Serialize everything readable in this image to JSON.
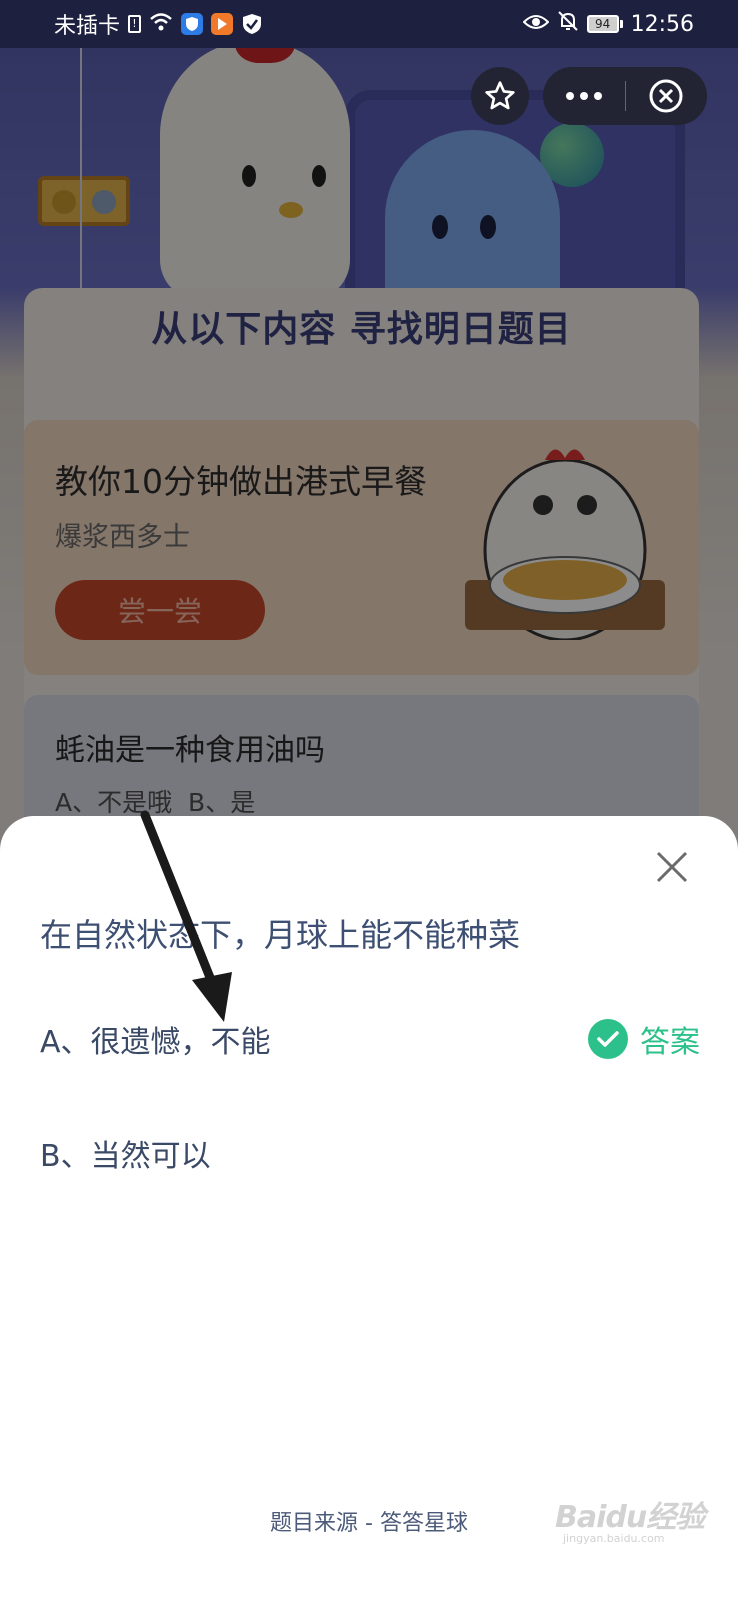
{
  "status_bar": {
    "carrier": "未插卡",
    "battery": "94",
    "time": "12:56"
  },
  "background_page": {
    "section_header": "从以下内容 寻找明日题目",
    "recipe_card": {
      "title": "教你10分钟做出港式早餐",
      "subtitle": "爆浆西多士",
      "button_label": "尝一尝"
    },
    "quiz_preview": {
      "question": "蚝油是一种食用油吗",
      "options": "A、不是哦 B、是"
    }
  },
  "sheet": {
    "question": "在自然状态下，月球上能不能种菜",
    "options": [
      {
        "label": "A、很遗憾，不能",
        "is_answer": true
      },
      {
        "label": "B、当然可以",
        "is_answer": false
      }
    ],
    "answer_label": "答案",
    "footer": "题目来源 - 答答星球"
  },
  "watermark": {
    "logo": "Baidu经验",
    "url": "jingyan.baidu.com"
  },
  "icons": {
    "fav": "star-icon",
    "more": "more-dots-icon",
    "close_miniapp": "close-circle-icon",
    "close_sheet": "close-icon",
    "check": "check-circle-icon"
  },
  "colors": {
    "accent_green": "#2cc08a",
    "question_text": "#3d4f72",
    "try_button": "#c7472a"
  }
}
